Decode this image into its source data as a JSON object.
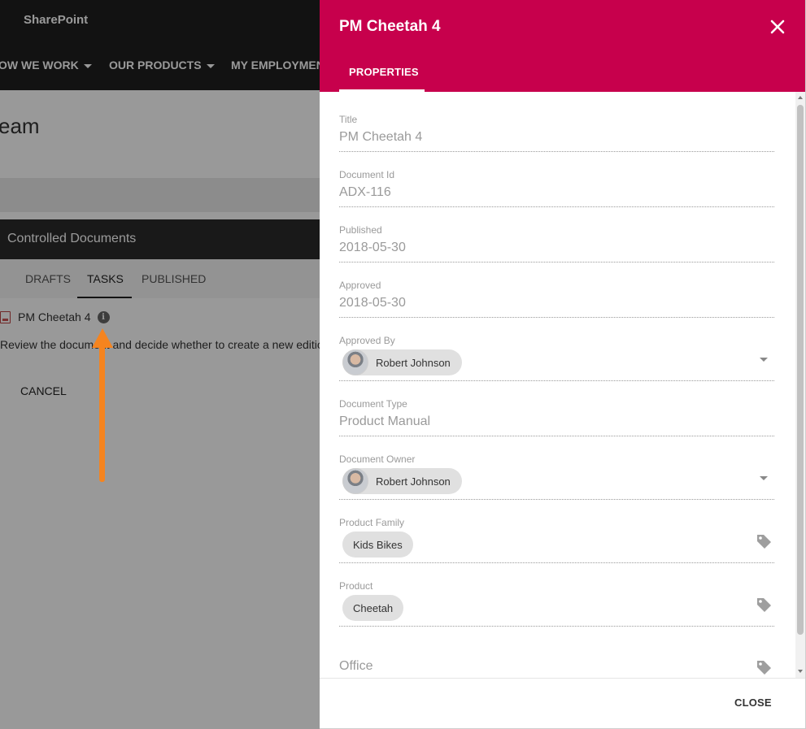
{
  "background": {
    "brand": "SharePoint",
    "nav": [
      {
        "label": "OW WE WORK"
      },
      {
        "label": "OUR PRODUCTS"
      },
      {
        "label": "MY EMPLOYMEN"
      }
    ],
    "page_title": "eam",
    "webpart_title": "Controlled Documents",
    "tabs": [
      {
        "label": "DRAFTS"
      },
      {
        "label": "TASKS"
      },
      {
        "label": "PUBLISHED"
      }
    ],
    "active_tab": "TASKS",
    "task": {
      "name": "PM Cheetah 4",
      "info_glyph": "i",
      "description": "Review the document and decide whether to create a new editio"
    },
    "cancel_label": "CANCEL",
    "highlight_arrow_color": "#f5841f"
  },
  "panel": {
    "title": "PM Cheetah 4",
    "header_color": "#c7004c",
    "tab": "PROPERTIES",
    "fields": {
      "title": {
        "label": "Title",
        "value": "PM Cheetah 4"
      },
      "document_id": {
        "label": "Document Id",
        "value": "ADX-116"
      },
      "published": {
        "label": "Published",
        "value": "2018-05-30"
      },
      "approved": {
        "label": "Approved",
        "value": "2018-05-30"
      },
      "approved_by": {
        "label": "Approved By",
        "value": "Robert Johnson"
      },
      "document_type": {
        "label": "Document Type",
        "value": "Product Manual"
      },
      "document_owner": {
        "label": "Document Owner",
        "value": "Robert Johnson"
      },
      "product_family": {
        "label": "Product Family",
        "value": "Kids Bikes"
      },
      "product": {
        "label": "Product",
        "value": "Cheetah"
      },
      "office": {
        "placeholder": "Office"
      }
    },
    "close_label": "CLOSE"
  }
}
